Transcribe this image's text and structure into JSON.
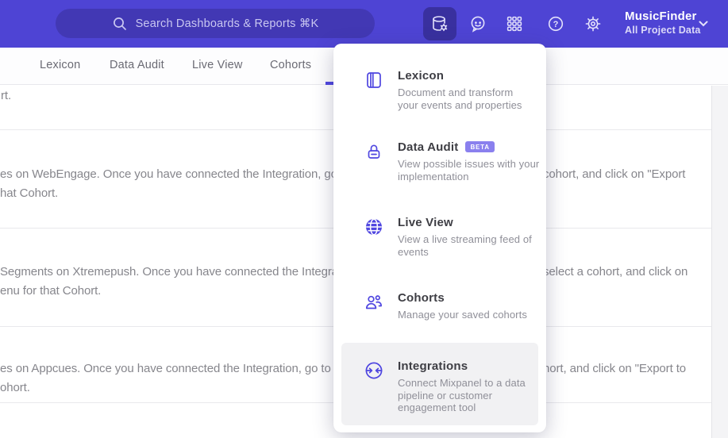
{
  "colors": {
    "accent": "#4f46e0",
    "header_bg": "#4e44d4",
    "badge_bg": "#8a80ee",
    "active_icon_bg": "#39309f"
  },
  "header": {
    "search": {
      "placeholder": "Search Dashboards & Reports ⌘K"
    },
    "icons": [
      "data-management-icon",
      "feedback-icon",
      "apps-grid-icon",
      "help-icon",
      "gear-icon"
    ],
    "project": {
      "name": "MusicFinder",
      "scope": "All Project Data"
    }
  },
  "tabs": [
    {
      "label": "Lexicon"
    },
    {
      "label": "Data Audit"
    },
    {
      "label": "Live View"
    },
    {
      "label": "Cohorts"
    }
  ],
  "menu": {
    "items": [
      {
        "title": "Lexicon",
        "desc": "Document and transform your events and properties",
        "icon": "book-icon"
      },
      {
        "title": "Data Audit",
        "badge": "BETA",
        "desc": "View possible issues with your implementation",
        "icon": "audit-lock-icon"
      },
      {
        "title": "Live View",
        "desc": "View a live streaming feed of events",
        "icon": "globe-icon"
      },
      {
        "title": "Cohorts",
        "desc": "Manage your saved cohorts",
        "icon": "people-icon"
      },
      {
        "title": "Integrations",
        "desc": "Connect Mixpanel to a data pipeline or customer engagement tool",
        "icon": "sync-arrows-icon",
        "highlighted": true
      }
    ]
  },
  "background": {
    "top_fragment": "rt.",
    "rows": [
      {
        "line1": "es on WebEngage. Once you have connected the Integration, go to the",
        "line2": "hat Cohort.",
        "right": "cohort, and click on \"Export"
      },
      {
        "line1": "Segments on Xtremepush. Once you have connected the Integration,",
        "line2": "enu for that Cohort.",
        "right": "select a cohort, and click on"
      },
      {
        "line1": "es on Appcues. Once you have connected the Integration, go to the M",
        "line2": "ohort.",
        "right": "hort, and click on \"Export to"
      }
    ]
  }
}
